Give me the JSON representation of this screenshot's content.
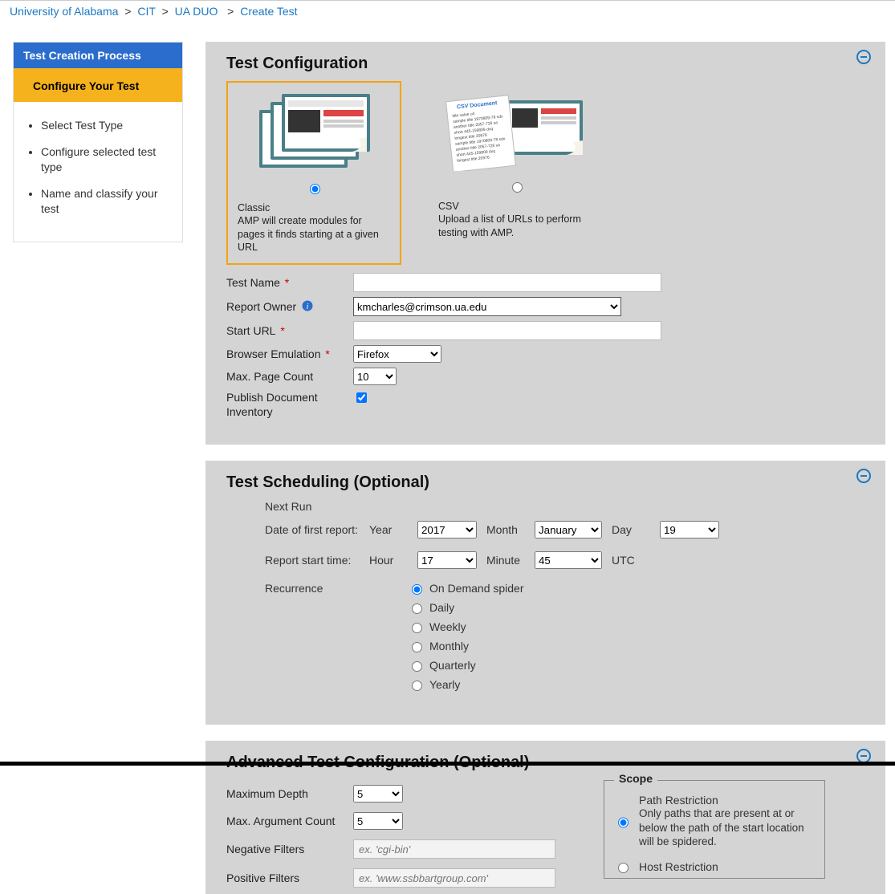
{
  "breadcrumb": {
    "org": "University of Alabama",
    "unit": "CIT",
    "project": "UA DUO",
    "current": "Create Test"
  },
  "sidebar": {
    "header": "Test Creation Process",
    "active": "Configure Your Test",
    "steps": [
      "Select Test Type",
      "Configure selected test type",
      "Name and classify your test"
    ]
  },
  "config": {
    "title": "Test Configuration",
    "types": {
      "classic": {
        "name": "Classic",
        "desc": "AMP will create modules for pages it finds starting at a given URL"
      },
      "csv": {
        "name": "CSV",
        "desc": "Upload a list of URLs to perform testing with AMP."
      }
    },
    "labels": {
      "test_name": "Test Name",
      "report_owner": "Report Owner",
      "start_url": "Start URL",
      "browser_emulation": "Browser Emulation",
      "max_page_count": "Max. Page Count",
      "publish_doc_inventory": "Publish Document Inventory"
    },
    "values": {
      "report_owner": "kmcharles@crimson.ua.edu",
      "browser_emulation": "Firefox",
      "max_page_count": "10"
    }
  },
  "scheduling": {
    "title": "Test Scheduling (Optional)",
    "next_run_label": "Next Run",
    "date_label": "Date of first report:",
    "time_label": "Report start time:",
    "recurrence_label": "Recurrence",
    "fields": {
      "year_label": "Year",
      "year": "2017",
      "month_label": "Month",
      "month": "January",
      "day_label": "Day",
      "day": "19",
      "hour_label": "Hour",
      "hour": "17",
      "minute_label": "Minute",
      "minute": "45",
      "tz": "UTC"
    },
    "recurrence": [
      "On Demand spider",
      "Daily",
      "Weekly",
      "Monthly",
      "Quarterly",
      "Yearly"
    ]
  },
  "advanced": {
    "title": "Advanced Test Configuration (Optional)",
    "labels": {
      "max_depth": "Maximum Depth",
      "max_arg_count": "Max. Argument Count",
      "negative_filters": "Negative Filters",
      "positive_filters": "Positive Filters"
    },
    "values": {
      "max_depth": "5",
      "max_arg_count": "5",
      "negative_placeholder": "ex. 'cgi-bin'",
      "positive_placeholder": "ex. 'www.ssbbartgroup.com'"
    },
    "scope": {
      "legend": "Scope",
      "path_title": "Path Restriction",
      "path_desc": "Only paths that are present at or below the path of the start location will be spidered.",
      "host_title": "Host Restriction"
    }
  }
}
